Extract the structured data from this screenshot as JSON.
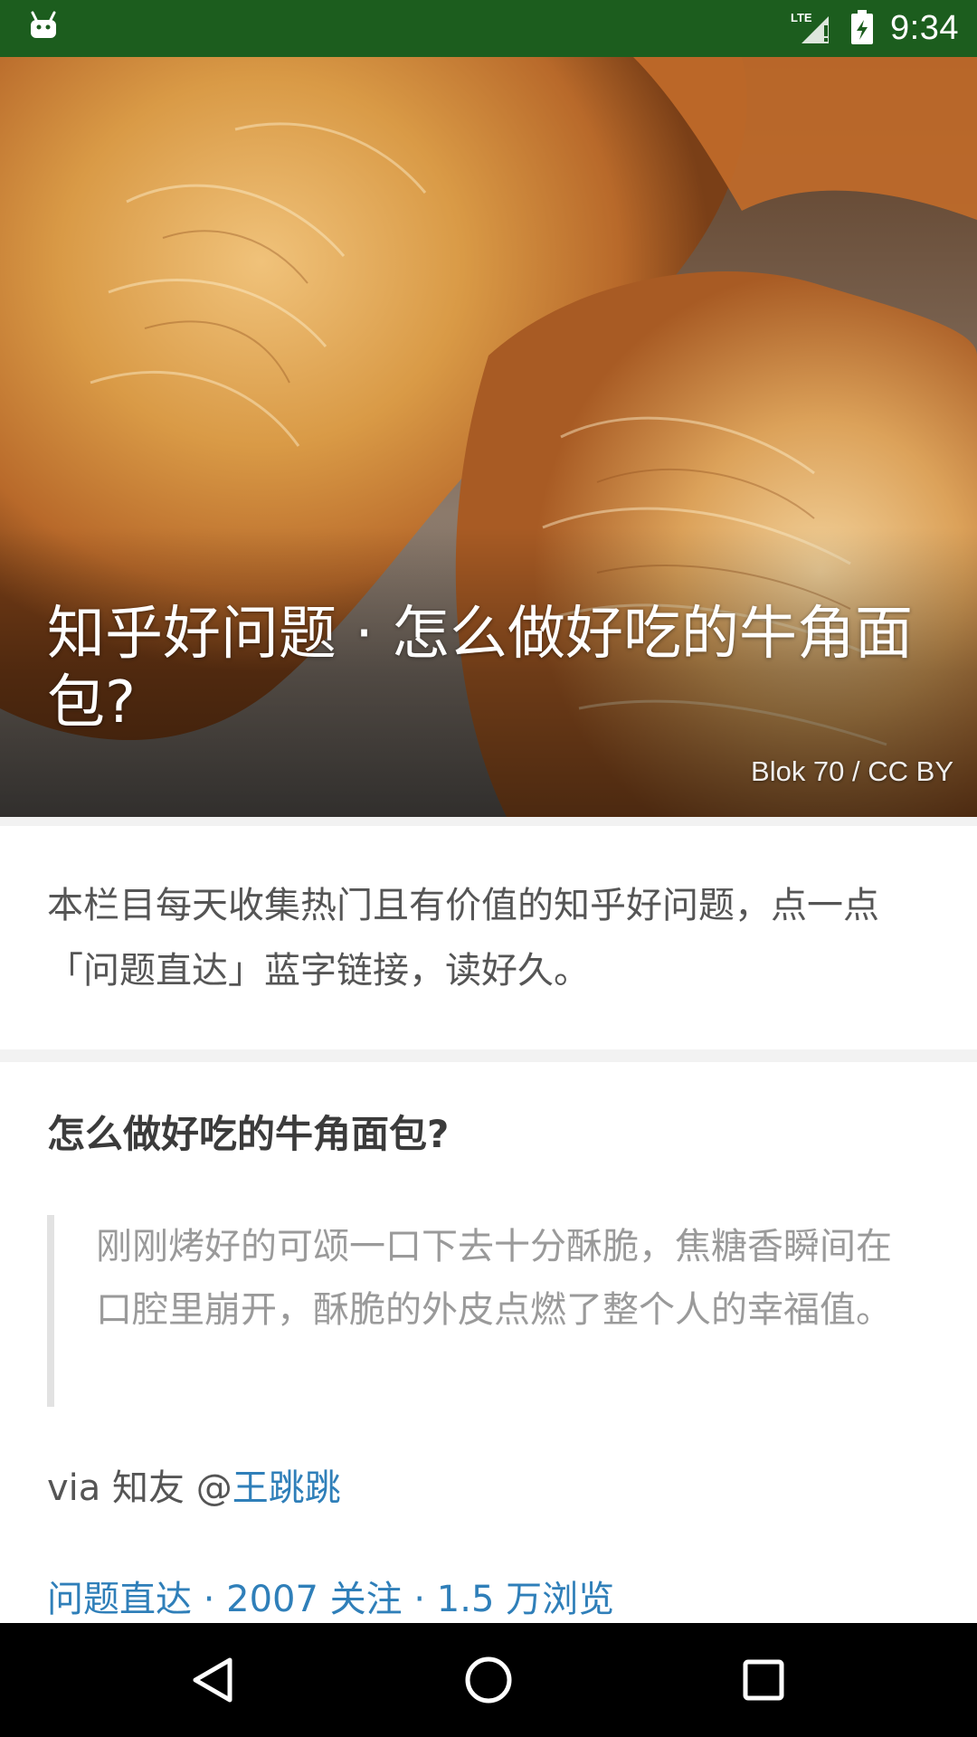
{
  "status_bar": {
    "time": "9:34",
    "network": "LTE",
    "icons": [
      "android-icon",
      "signal-icon",
      "battery-icon"
    ]
  },
  "hero": {
    "title": "知乎好问题 · 怎么做好吃的牛角面包?",
    "credit": "Blok 70 / CC BY"
  },
  "intro": {
    "text": "本栏目每天收集热门且有价值的知乎好问题，点一点「问题直达」蓝字链接，读好久。"
  },
  "question": {
    "title": "怎么做好吃的牛角面包?",
    "quote": "刚刚烤好的可颂一口下去十分酥脆，焦糖香瞬间在口腔里崩开，酥脆的外皮点燃了整个人的幸福值。",
    "via_prefix": "via 知友 @",
    "author": "王跳跳",
    "meta_link": "问题直达 · 2007 关注 · 1.5 万浏览"
  },
  "nav_bar": {
    "buttons": [
      "back-icon",
      "home-icon",
      "recents-icon"
    ]
  },
  "colors": {
    "status_bar": "#1c5d1e",
    "link": "#2f7fb9",
    "nav_bar": "#000000"
  }
}
